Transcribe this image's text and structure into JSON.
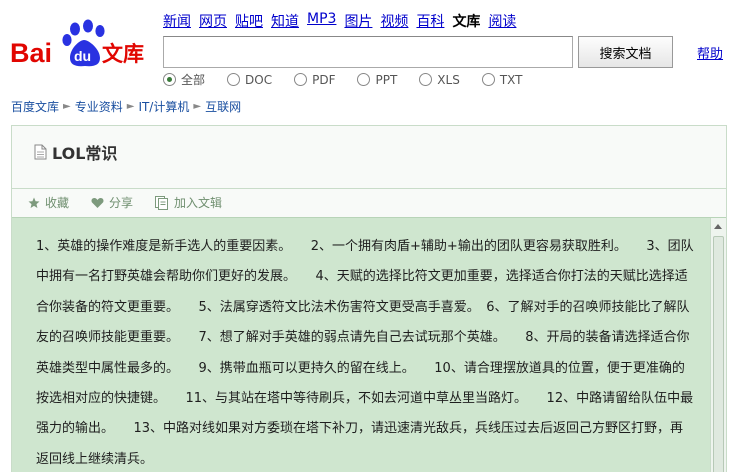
{
  "logo": {
    "bai": "Bai",
    "du": "du",
    "wenku": "文库"
  },
  "nav": {
    "items": [
      "新闻",
      "网页",
      "贴吧",
      "知道",
      "MP3",
      "图片",
      "视频",
      "百科"
    ],
    "current": "文库",
    "last": "阅读"
  },
  "search": {
    "value": "",
    "button_label": "搜索文档",
    "help_label": "帮助"
  },
  "filters": [
    "全部",
    "DOC",
    "PDF",
    "PPT",
    "XLS",
    "TXT"
  ],
  "breadcrumb": [
    "百度文库",
    "专业资料",
    "IT/计算机",
    "互联网"
  ],
  "doc": {
    "title": "LOL常识",
    "toolbar": {
      "collect": "收藏",
      "share": "分享",
      "add": "加入文辑"
    },
    "paragraph": "1、英雄的操作难度是新手选人的重要因素。　　2、一个拥有肉盾+辅助+输出的团队更容易获取胜利。　　3、团队中拥有一名打野英雄会帮助你们更好的发展。　　4、天赋的选择比符文更加重要，选择适合你打法的天赋比选择适合你装备的符文更重要。　　5、法属穿透符文比法术伤害符文更受高手喜爱。　6、了解对手的召唤师技能比了解队友的召唤师技能更重要。　　7、想了解对手英雄的弱点请先自己去试玩那个英雄。　　8、开局的装备请选择适合你英雄类型中属性最多的。　　9、携带血瓶可以更持久的留在线上。　　10、请合理摆放道具的位置，便于更准确的按选相对应的快捷键。　　11、与其站在塔中等待刷兵，不如去河道中草丛里当路灯。　　12、中路请留给队伍中最强力的输出。　　13、中路对线如果对方委琐在塔下补刀，请迅速清光敌兵，兵线压过去后返回己方野区打野，再返回线上继续清兵。"
  }
}
